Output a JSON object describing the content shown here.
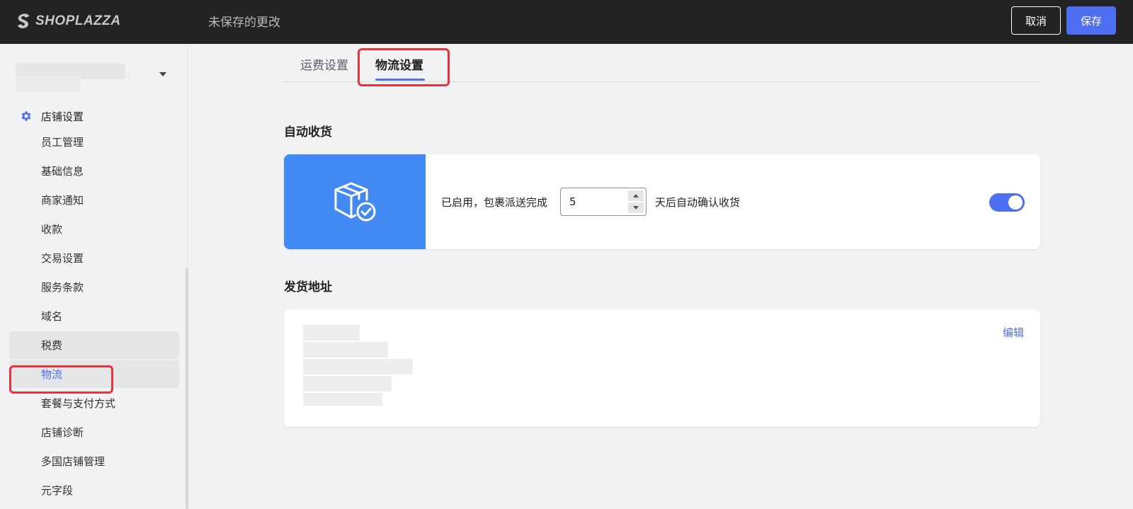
{
  "topbar": {
    "logo_text": "SHOPLAZZA",
    "unsaved_text": "未保存的更改",
    "cancel_label": "取消",
    "save_label": "保存"
  },
  "sidebar": {
    "section_label": "店铺设置",
    "items": [
      {
        "label": "员工管理"
      },
      {
        "label": "基础信息"
      },
      {
        "label": "商家通知"
      },
      {
        "label": "收款"
      },
      {
        "label": "交易设置"
      },
      {
        "label": "服务条款"
      },
      {
        "label": "域名"
      },
      {
        "label": "税费"
      },
      {
        "label": "物流",
        "active": true
      },
      {
        "label": "套餐与支付方式"
      },
      {
        "label": "店铺诊断"
      },
      {
        "label": "多国店铺管理"
      },
      {
        "label": "元字段"
      }
    ]
  },
  "tabs": [
    {
      "label": "运费设置"
    },
    {
      "label": "物流设置",
      "active": true
    }
  ],
  "auto_receipt": {
    "title": "自动收货",
    "prefix_text": "已启用，包裹派送完成",
    "days_value": "5",
    "suffix_text": "天后自动确认收货",
    "enabled": true
  },
  "shipping_address": {
    "title": "发货地址",
    "edit_label": "编辑"
  },
  "colors": {
    "accent": "#4e6ef2",
    "icon_panel": "#4289f4",
    "highlight": "#e8323c",
    "topbar": "#232323"
  },
  "icons": [
    "shoplazza-logo-icon",
    "gear-icon",
    "chevron-down-icon",
    "package-check-icon",
    "arrow-up-icon",
    "arrow-down-icon"
  ]
}
